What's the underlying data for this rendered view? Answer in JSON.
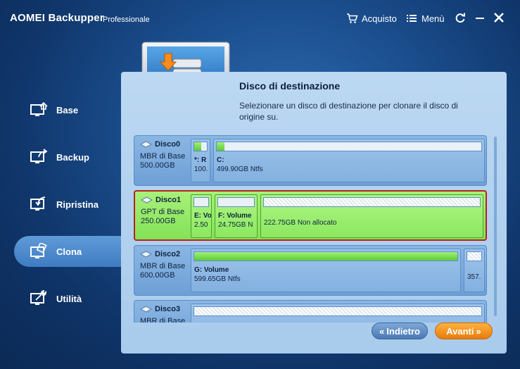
{
  "app": {
    "title": "AOMEI Backupper",
    "edition": "Professionale"
  },
  "titlebar": {
    "purchase_label": "Acquisto",
    "menu_label": "Menù"
  },
  "sidebar": {
    "items": [
      {
        "label": "Base",
        "icon": "home-icon"
      },
      {
        "label": "Backup",
        "icon": "backup-icon"
      },
      {
        "label": "Ripristina",
        "icon": "restore-icon"
      },
      {
        "label": "Clona",
        "icon": "clone-icon",
        "active": true
      },
      {
        "label": "Utilità",
        "icon": "tools-icon"
      }
    ]
  },
  "panel": {
    "title": "Disco di destinazione",
    "description": "Selezionare un disco di destinazione per clonare il disco di origine su."
  },
  "disks": [
    {
      "name": "Disco0",
      "type": "MBR di Base",
      "size": "500.00GB",
      "partitions": [
        {
          "name": "*: R",
          "size": "100."
        },
        {
          "name": "C:",
          "size": "499.90GB Ntfs"
        }
      ]
    },
    {
      "name": "Disco1",
      "type": "GPT di Base",
      "size": "250.00GB",
      "selected": true,
      "partitions": [
        {
          "name": "E: Vo",
          "size": "2.50"
        },
        {
          "name": "F: Volume",
          "size": "24.75GB N"
        },
        {
          "name": "",
          "size": "222.75GB Non allocato"
        }
      ]
    },
    {
      "name": "Disco2",
      "type": "MBR di Base",
      "size": "600.00GB",
      "partitions": [
        {
          "name": "G: Volume",
          "size": "599.65GB Ntfs"
        },
        {
          "name": "",
          "size": "357."
        }
      ]
    },
    {
      "name": "Disco3",
      "type": "MBR di Base",
      "size": "",
      "partitions": []
    }
  ],
  "buttons": {
    "back_label": "Indietro",
    "next_label": "Avanti"
  },
  "colors": {
    "accent_orange": "#e77b0d",
    "selection_red": "#b82220",
    "selected_green": "#8ce85f"
  }
}
